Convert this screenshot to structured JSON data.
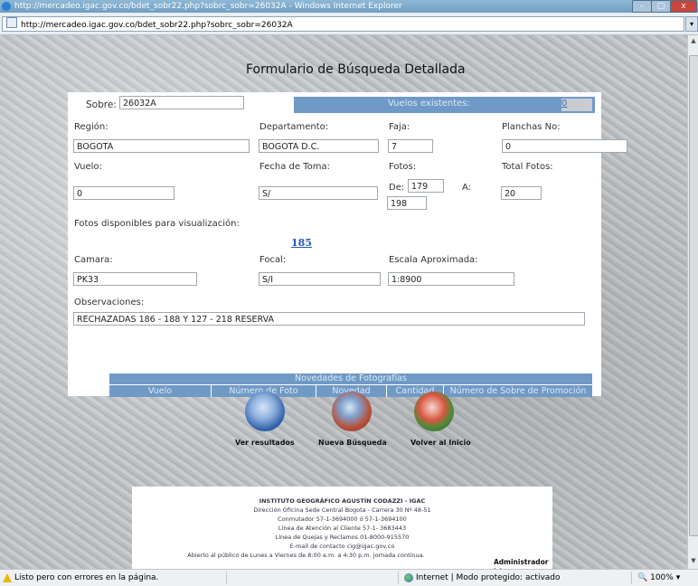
{
  "window": {
    "title": "http://mercadeo.igac.gov.co/bdet_sobr22.php?sobrc_sobr=26032A - Windows Internet Explorer",
    "address": "http://mercadeo.igac.gov.co/bdet_sobr22.php?sobrc_sobr=26032A",
    "min_glyph": "–",
    "max_glyph": "□",
    "close_glyph": "x",
    "dropdown_glyph": "▾"
  },
  "form": {
    "title": "Formulario de Búsqueda Detallada",
    "sobre_label": "Sobre:",
    "sobre_value": "26032A",
    "vuelos_label": "Vuelos existentes:",
    "vuelos_count": "0",
    "region_label": "Región:",
    "region_value": "BOGOTA",
    "departamento_label": "Departamento:",
    "departamento_value": "BOGOTA D.C.",
    "faja_label": "Faja:",
    "faja_value": "7",
    "planchas_label": "Planchas No:",
    "planchas_value": "0",
    "vuelo_label": "Vuelo:",
    "vuelo_value": "0",
    "fecha_label": "Fecha de Toma:",
    "fecha_value": "S/",
    "fotos_label": "Fotos:",
    "de_label": "De:",
    "de_value": "179",
    "a_label": "A:",
    "a_value": "198",
    "total_label": "Total Fotos:",
    "total_value": "20",
    "disponibles_label": "Fotos disponibles para visualización:",
    "disponibles_link": "185",
    "camara_label": "Camara:",
    "camara_value": "PK33",
    "focal_label": "Focal:",
    "focal_value": "S/I",
    "escala_label": "Escala Aproximada:",
    "escala_value": "1:8900",
    "obs_label": "Observaciones:",
    "obs_value": "RECHAZADAS 186 - 188 Y 127 - 218 RESERVA"
  },
  "novedades": {
    "title": "Novedades de Fotografías",
    "columns": [
      "Vuelo",
      "Número de Foto",
      "Novedad",
      "Cantidad",
      "Número de Sobre de Promoción"
    ]
  },
  "buttons": {
    "ver": "Ver resultados",
    "nueva": "Nueva Búsqueda",
    "volver": "Volver al Inicio"
  },
  "footer": {
    "lines": [
      "INSTITUTO GEOGRÁFICO AGUSTÍN CODAZZI - IGAC",
      "Dirección Oficina Sede Central Bogota - Carrera 30 Nº 48-51",
      "Conmutador 57-1-3694000 ó 57-1-3694100",
      "Línea de Atención al Cliente 57-1- 3683443",
      "Línea de Quejas y Reclamos 01-8000-915570",
      "E-mail de contacto cig@igac.gov.co",
      "Abierto al público de Lunes a Viernes de 8:00 a.m. a 4:30 p.m. jornada continua."
    ],
    "admin": "Administrador >>"
  },
  "statusbar": {
    "status": "Listo pero con errores en la página.",
    "zone": "Internet | Modo protegido: activado",
    "zoom": "100%",
    "zoom_icon": "🔍",
    "zoom_dropdown": "▾"
  },
  "colors": {
    "header_blue": "#6f9ac6",
    "link_blue": "#2257b8"
  }
}
